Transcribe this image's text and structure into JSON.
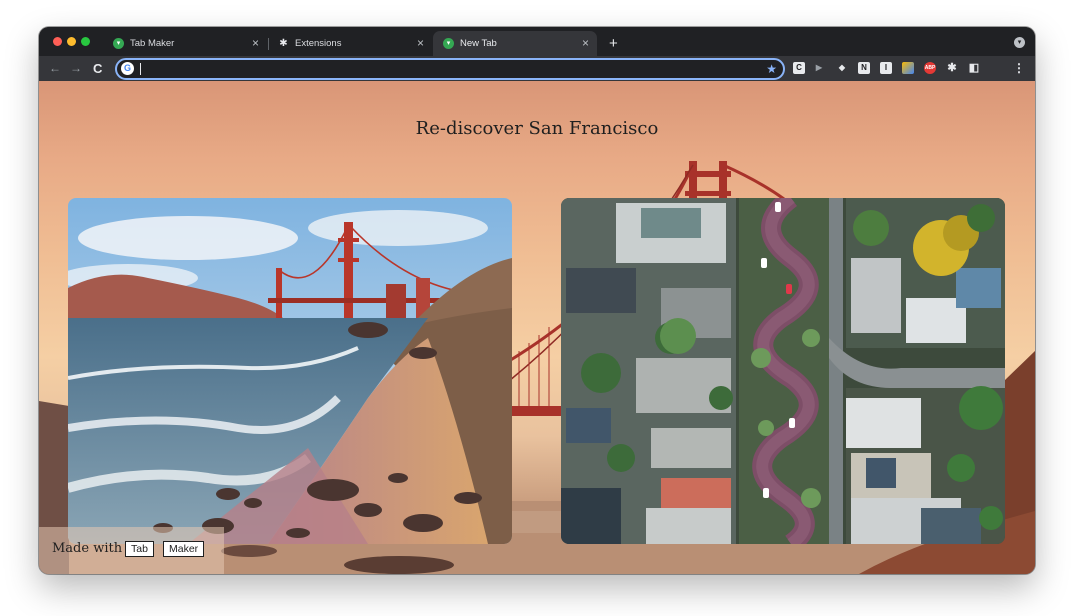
{
  "browser": {
    "tabs": [
      {
        "title": "Tab Maker",
        "favicon": "tab-maker-icon",
        "active": false
      },
      {
        "title": "Extensions",
        "favicon": "puzzle-icon",
        "active": false
      },
      {
        "title": "New Tab",
        "favicon": "tab-maker-icon",
        "active": true
      }
    ],
    "tab_close_glyph": "×",
    "new_tab_glyph": "+",
    "nav": {
      "back": "←",
      "forward": "→",
      "reload": "C"
    },
    "omnibox": {
      "value": "",
      "placeholder": "",
      "bookmark_glyph": "★"
    },
    "extensions": [
      {
        "name": "c-extension-icon",
        "glyph": "C"
      },
      {
        "name": "play-extension-icon",
        "glyph": "▶"
      },
      {
        "name": "incognito-extension-icon",
        "glyph": "◆"
      },
      {
        "name": "n-extension-icon",
        "glyph": "N"
      },
      {
        "name": "i-extension-icon",
        "glyph": "I"
      },
      {
        "name": "colorful-extension-icon",
        "glyph": "■"
      },
      {
        "name": "adblock-extension-icon",
        "glyph": "ABP"
      },
      {
        "name": "puzzle-icon",
        "glyph": "✱"
      },
      {
        "name": "sidebar-icon",
        "glyph": "◧"
      },
      {
        "name": "menu-icon",
        "glyph": "⋮"
      }
    ],
    "colors": {
      "frame": "#202124",
      "active_tab": "#35363a",
      "accent": "#8ab4f8",
      "tab_maker_green": "#34a853"
    }
  },
  "page": {
    "title": "Re-discover San Francisco",
    "credit": {
      "prefix": "Made with",
      "word1": "Tab",
      "word2": "Maker"
    },
    "images": [
      {
        "name": "golden-gate-beach-photo"
      },
      {
        "name": "lombard-street-aerial-photo"
      }
    ]
  }
}
